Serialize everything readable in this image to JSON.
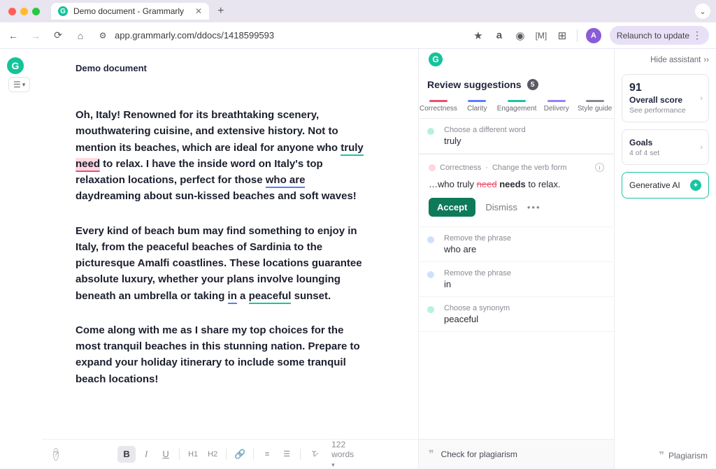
{
  "browser": {
    "tab_title": "Demo document - Grammarly",
    "url": "app.grammarly.com/ddocs/1418599593",
    "relaunch": "Relaunch to update",
    "avatar_initial": "A"
  },
  "doc": {
    "title": "Demo document",
    "p1a": "Oh, Italy! Renowned for its breathtaking scenery, mouthwatering cuisine, and extensive history. Not to mention its beaches, which are ideal for anyone who ",
    "truly": "truly",
    "need": "need",
    "p1b": " to relax. I have the inside word on Italy's top relaxation locations, perfect for those ",
    "who_are": "who are",
    "p1c": " daydreaming about sun-kissed beaches and soft waves!",
    "p2a": "Every kind of beach bum may find something to enjoy in Italy, from the peaceful beaches of Sardinia to the picturesque Amalfi coastlines. These locations guarantee absolute luxury, whether your plans involve lounging beneath an umbrella or taking ",
    "in": "in",
    "p2b": " a ",
    "peaceful": "peaceful",
    "p2c": " sunset.",
    "p3": "Come along with me as I share my top choices for the most tranquil beaches in this stunning nation. Prepare to expand your holiday itinerary to include some tranquil beach locations!",
    "word_count": "122 words"
  },
  "panel": {
    "title": "Review suggestions",
    "count": "5",
    "cats": {
      "correctness": "Correctness",
      "clarity": "Clarity",
      "engagement": "Engagement",
      "delivery": "Delivery",
      "style": "Style guide"
    },
    "s1": {
      "label": "Choose a different word",
      "word": "truly"
    },
    "s2": {
      "head1": "Correctness",
      "head2": "Change the verb form",
      "ctx_pre": "…who truly ",
      "ctx_strike": "need",
      "ctx_bold": "needs",
      "ctx_post": " to relax.",
      "accept": "Accept",
      "dismiss": "Dismiss"
    },
    "s3": {
      "label": "Remove the phrase",
      "word": "who are"
    },
    "s4": {
      "label": "Remove the phrase",
      "word": "in"
    },
    "s5": {
      "label": "Choose a synonym",
      "word": "peaceful"
    },
    "plagiarism": "Check for plagiarism"
  },
  "rail": {
    "hide": "Hide assistant",
    "score": "91",
    "overall": "Overall score",
    "see_perf": "See performance",
    "goals": "Goals",
    "goals_sub": "4 of 4 set",
    "genai": "Generative AI",
    "plagiarism": "Plagiarism"
  }
}
